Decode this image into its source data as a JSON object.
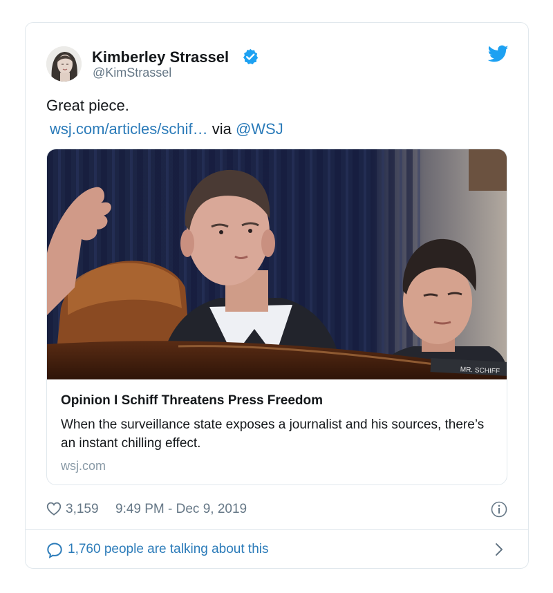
{
  "author": {
    "name": "Kimberley Strassel",
    "handle": "@KimStrassel",
    "verified": true
  },
  "tweet": {
    "text": "Great piece.",
    "link_text": "wsj.com/articles/schif…",
    "via_text": " via ",
    "mention": "@WSJ"
  },
  "card": {
    "title": "Opinion I Schiff Threatens Press Freedom",
    "description": "When the surveillance state exposes a journalist and his sources, there’s an instant chilling effect.",
    "domain": "wsj.com",
    "nameplate_text": "MR. SCHIFF"
  },
  "footer": {
    "likes": "3,159",
    "timestamp": "9:49 PM - Dec 9, 2019",
    "conversation": "1,760 people are talking about this"
  },
  "icons": {
    "verified": "verified-badge-icon",
    "logo": "twitter-bird-icon",
    "like": "heart-icon",
    "info": "info-icon",
    "reply": "speech-bubble-icon",
    "open": "chevron-right-icon"
  },
  "colors": {
    "link": "#2b7bb9",
    "secondary_text": "#657786",
    "twitter_blue": "#1da1f2",
    "border": "#e1e8ed"
  }
}
